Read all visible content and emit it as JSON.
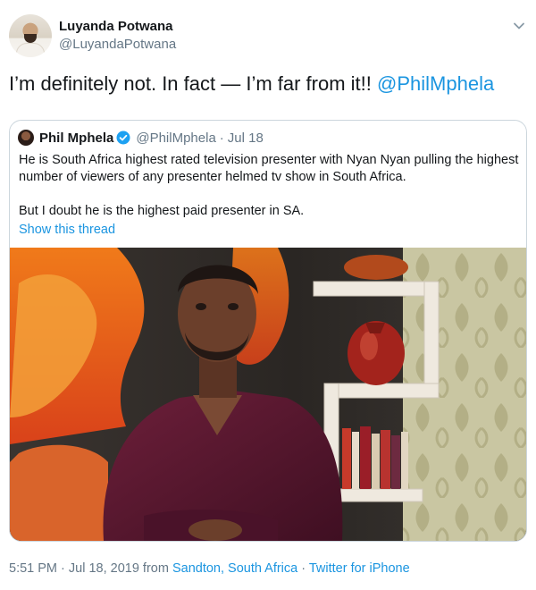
{
  "author": {
    "name": "Luyanda Potwana",
    "handle": "@LuyandaPotwana"
  },
  "tweet": {
    "text": "I’m definitely not. In fact — I’m far from it!! ",
    "mention": "@PhilMphela"
  },
  "quoted": {
    "name": "Phil Mphela",
    "handle": "@PhilMphela",
    "separator": "·",
    "date": "Jul 18",
    "body": [
      "He is South Africa highest rated television presenter with Nyan Nyan pulling the highest number of viewers of any presenter helmed tv show in South Africa.",
      "But I doubt he is the highest paid presenter in SA."
    ],
    "show_thread": "Show this thread"
  },
  "footer": {
    "time_date": "5:51 PM · Jul 18, 2019 from ",
    "location": "Sandton, South Africa",
    "separator": " · ",
    "source": "Twitter for iPhone"
  },
  "icons": {
    "caret": "chevron-down-icon",
    "verified": "verified-badge-icon"
  },
  "colors": {
    "link": "#1b95e0",
    "secondary_text": "#657786",
    "border": "#ccd6dd",
    "shirt": "#5a1830"
  }
}
